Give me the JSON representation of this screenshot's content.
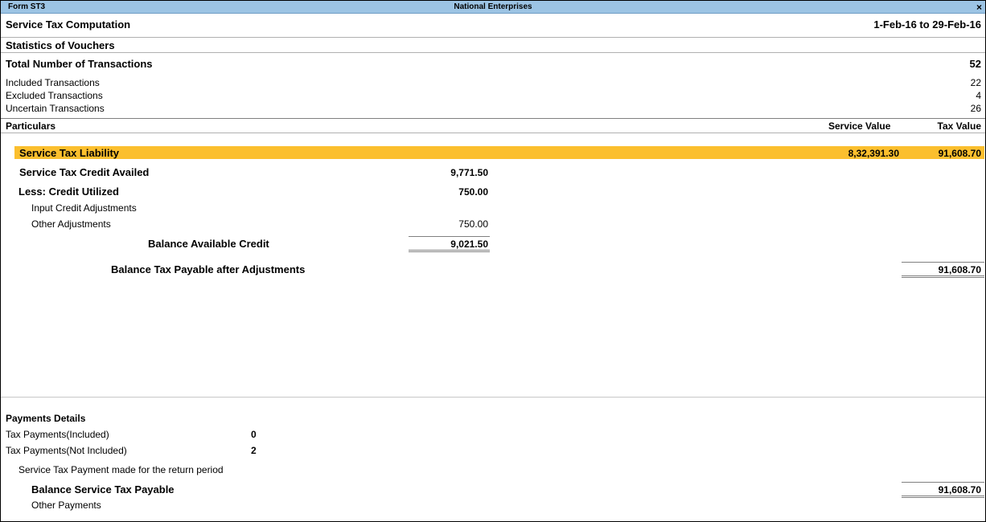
{
  "window": {
    "form_name": "Form ST3",
    "company": "National Enterprises",
    "close_glyph": "×"
  },
  "header": {
    "title": "Service Tax Computation",
    "period": "1-Feb-16 to 29-Feb-16"
  },
  "statistics": {
    "heading": "Statistics of Vouchers",
    "total_label": "Total Number of Transactions",
    "total_value": "52",
    "rows": [
      {
        "label": "Included Transactions",
        "value": "22"
      },
      {
        "label": "Excluded Transactions",
        "value": "4"
      },
      {
        "label": "Uncertain Transactions",
        "value": "26"
      }
    ]
  },
  "columns": {
    "particulars": "Particulars",
    "service_value": "Service Value",
    "tax_value": "Tax Value"
  },
  "liability": {
    "label": "Service Tax Liability",
    "service_value": "8,32,391.30",
    "tax_value": "91,608.70"
  },
  "credit": {
    "availed_label": "Service Tax Credit Availed",
    "availed_value": "9,771.50",
    "utilized_label": "Less: Credit Utilized",
    "utilized_value": "750.00",
    "input_adj_label": "Input Credit Adjustments",
    "other_adj_label": "Other Adjustments",
    "other_adj_value": "750.00",
    "balance_label": "Balance Available Credit",
    "balance_value": "9,021.50"
  },
  "payable": {
    "label": "Balance Tax Payable after Adjustments",
    "value": "91,608.70"
  },
  "payments": {
    "heading": "Payments Details",
    "included_label": "Tax Payments(Included)",
    "included_value": "0",
    "not_included_label": "Tax Payments(Not Included)",
    "not_included_value": "2",
    "return_period_label": "Service Tax Payment made for the return period",
    "balance_label": "Balance Service Tax Payable",
    "balance_value": "91,608.70",
    "other_label": "Other Payments"
  }
}
